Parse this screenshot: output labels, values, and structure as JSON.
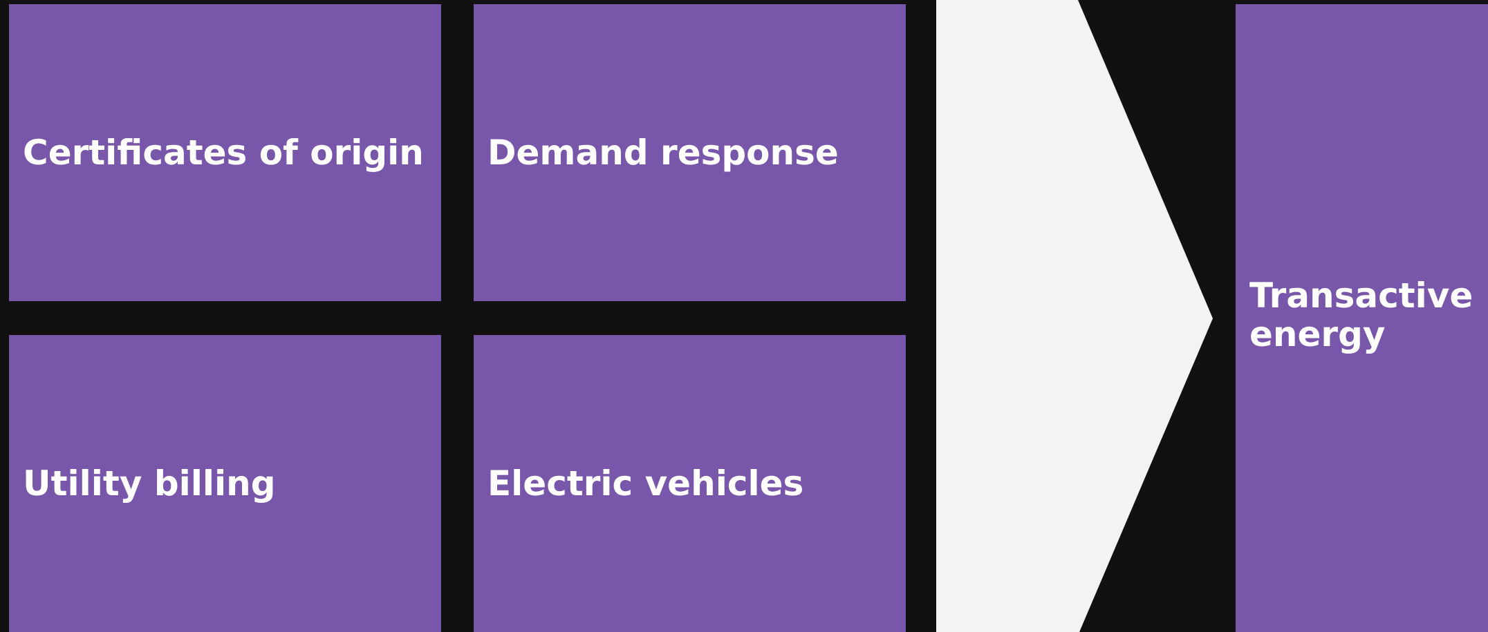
{
  "tiles": [
    {
      "label": "Certificates of origin"
    },
    {
      "label": "Demand response"
    },
    {
      "label": "Utility billing"
    },
    {
      "label": "Electric vehicles"
    }
  ],
  "result": {
    "label": "Transactive energy"
  },
  "colors": {
    "tile": "#7856aa",
    "background": "#111111",
    "arrow": "#f3f4f2",
    "text": "#ffffff"
  }
}
